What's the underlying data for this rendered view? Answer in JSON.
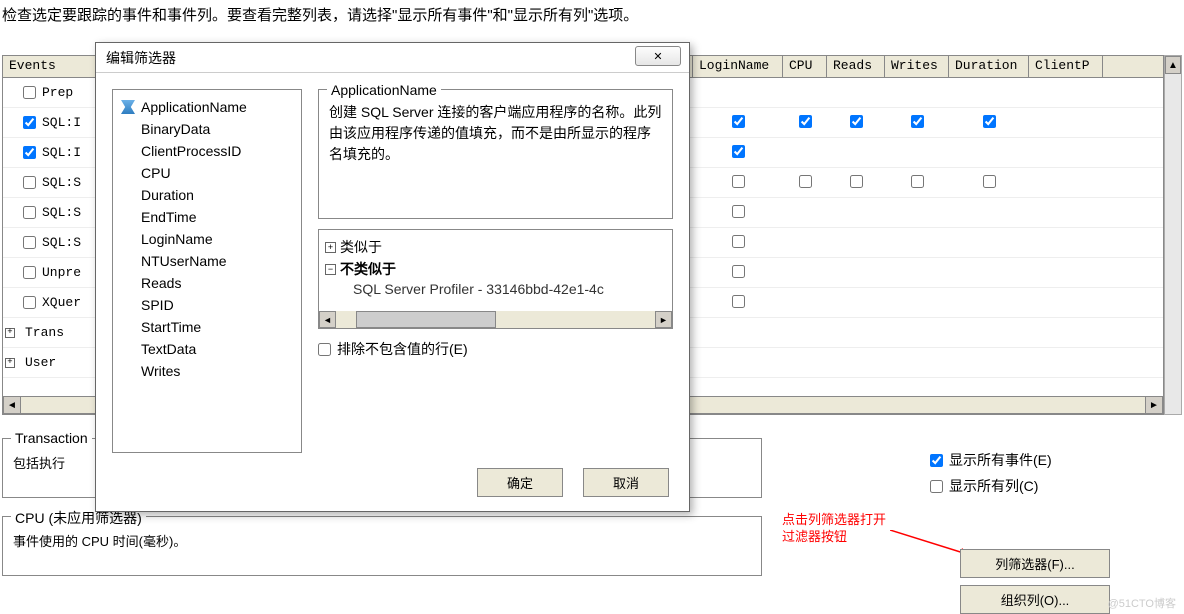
{
  "intro": "检查选定要跟踪的事件和事件列。要查看完整列表，请选择\"显示所有事件\"和\"显示所有列\"选项。",
  "grid": {
    "headers": {
      "events": "Events",
      "loginname": "LoginName",
      "cpu": "CPU",
      "reads": "Reads",
      "writes": "Writes",
      "duration": "Duration",
      "clientp": "ClientP"
    },
    "rows": [
      {
        "label": "Prep",
        "ev": false,
        "login": null,
        "cpu": null,
        "reads": null,
        "writes": null,
        "dur": null
      },
      {
        "label": "SQL:I",
        "ev": true,
        "login": true,
        "cpu": true,
        "reads": true,
        "writes": true,
        "dur": true
      },
      {
        "label": "SQL:I",
        "ev": true,
        "login": true,
        "cpu": null,
        "reads": null,
        "writes": null,
        "dur": null
      },
      {
        "label": "SQL:S",
        "ev": false,
        "login": false,
        "cpu": false,
        "reads": false,
        "writes": false,
        "dur": false
      },
      {
        "label": "SQL:S",
        "ev": false,
        "login": false,
        "cpu": null,
        "reads": null,
        "writes": null,
        "dur": null
      },
      {
        "label": "SQL:S",
        "ev": false,
        "login": false,
        "cpu": null,
        "reads": null,
        "writes": null,
        "dur": null
      },
      {
        "label": "Unpre",
        "ev": false,
        "login": false,
        "cpu": null,
        "reads": null,
        "writes": null,
        "dur": null
      },
      {
        "label": "XQuer",
        "ev": false,
        "login": false,
        "cpu": null,
        "reads": null,
        "writes": null,
        "dur": null
      },
      {
        "label": "Trans",
        "ev": null,
        "expand": true,
        "login": null
      },
      {
        "label": "User",
        "ev": null,
        "expand": true,
        "login": null
      }
    ]
  },
  "groupboxes": {
    "transactions": {
      "title": "Transaction",
      "body": "包括执行"
    },
    "cpu": {
      "title": "CPU (未应用筛选器)",
      "body": "事件使用的 CPU 时间(毫秒)。"
    }
  },
  "options": {
    "show_all_events": "显示所有事件(E)",
    "show_all_columns": "显示所有列(C)",
    "show_all_events_checked": true,
    "show_all_columns_checked": false
  },
  "buttons": {
    "column_filter": "列筛选器(F)...",
    "organize_columns": "组织列(O)..."
  },
  "annotation": {
    "line1": "点击列筛选器打开",
    "line2": "过滤器按钮"
  },
  "dialog": {
    "title": "编辑筛选器",
    "columns": [
      "ApplicationName",
      "BinaryData",
      "ClientProcessID",
      "CPU",
      "Duration",
      "EndTime",
      "LoginName",
      "NTUserName",
      "Reads",
      "SPID",
      "StartTime",
      "TextData",
      "Writes"
    ],
    "selected_index": 0,
    "description": {
      "title": "ApplicationName",
      "body": "创建 SQL Server 连接的客户端应用程序的名称。此列由该应用程序传递的值填充，而不是由所显示的程序名填充的。"
    },
    "tree": {
      "like": "类似于",
      "not_like": "不类似于",
      "value": "SQL Server Profiler - 33146bbd-42e1-4c"
    },
    "exclude_empty": "排除不包含值的行(E)",
    "exclude_checked": false,
    "ok": "确定",
    "cancel": "取消"
  },
  "watermark": "@51CTO博客"
}
